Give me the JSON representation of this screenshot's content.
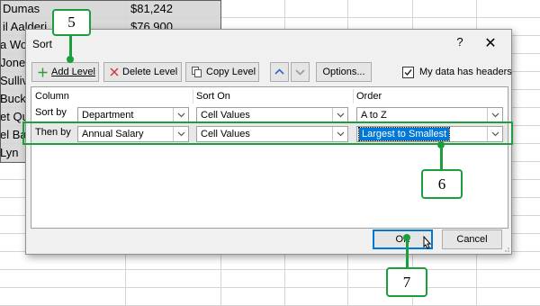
{
  "sheet": {
    "rows": [
      {
        "name": "Dumas",
        "salary": "$81,242"
      },
      {
        "name": "il Aalderi",
        "salary": "$76,900"
      },
      {
        "name": "a Wo",
        "salary": ""
      },
      {
        "name": " Jone",
        "salary": ""
      },
      {
        "name": "Sulliv",
        "salary": ""
      },
      {
        "name": "Buck",
        "salary": ""
      },
      {
        "name": "et Qu",
        "salary": ""
      },
      {
        "name": "el Ba",
        "salary": ""
      },
      {
        "name": " Lyn",
        "salary": ""
      }
    ]
  },
  "dialog": {
    "title": "Sort",
    "help": "?",
    "close": "✕",
    "toolbar": {
      "add_level": "Add Level",
      "delete_level": "Delete Level",
      "copy_level": "Copy Level",
      "options": "Options...",
      "headers_checkbox_label": "My data has headers",
      "headers_checked": true
    },
    "columns": {
      "column": "Column",
      "sort_on": "Sort On",
      "order": "Order"
    },
    "levels": [
      {
        "label": "Sort by",
        "column": "Department",
        "sort_on": "Cell Values",
        "order": "A to Z"
      },
      {
        "label": "Then by",
        "column": "Annual Salary",
        "sort_on": "Cell Values",
        "order": "Largest to Smallest"
      }
    ],
    "ok_label": "OK",
    "cancel_label": "Cancel"
  },
  "callouts": {
    "step_add": "5",
    "step_order": "6",
    "step_ok": "7"
  },
  "colors": {
    "callout_green": "#1b9e3e",
    "selection_blue": "#0078d7",
    "add_icon_green": "#2e9e3a",
    "delete_icon_red": "#d13438"
  }
}
